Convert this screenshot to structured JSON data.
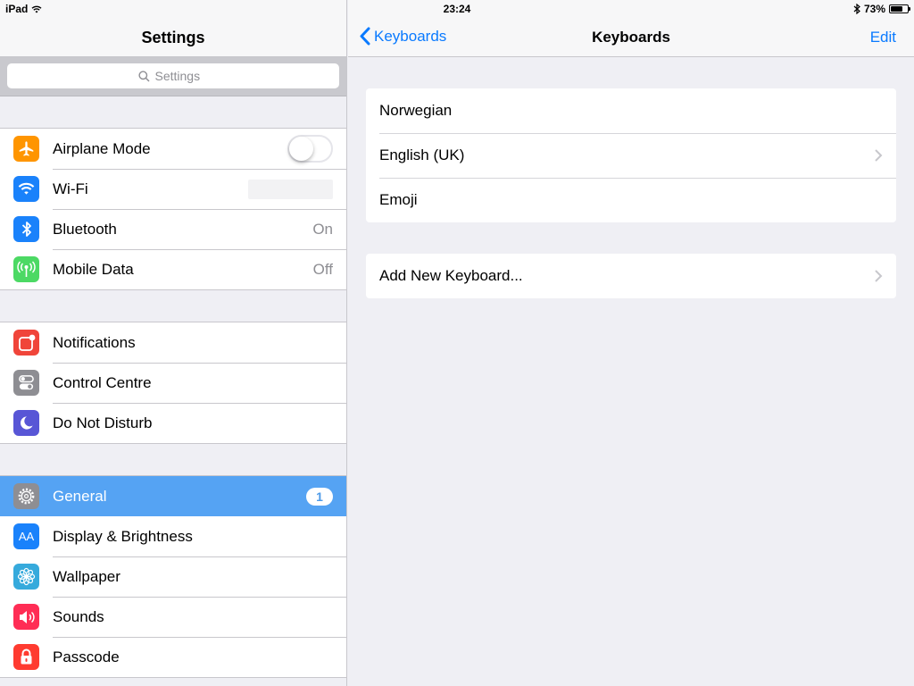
{
  "status_bar": {
    "device": "iPad",
    "time": "23:24",
    "battery": "73%",
    "battery_level": 0.73
  },
  "master": {
    "title": "Settings",
    "search_placeholder": "Settings",
    "groups": [
      [
        {
          "label": "Airplane Mode",
          "icon": "airplane-icon",
          "color": "#ff9500"
        },
        {
          "label": "Wi-Fi",
          "icon": "wifi-icon",
          "color": "#1a82fb"
        },
        {
          "label": "Bluetooth",
          "icon": "bluetooth-icon",
          "color": "#1a82fb",
          "value": "On"
        },
        {
          "label": "Mobile Data",
          "icon": "cellular-icon",
          "color": "#4cd964",
          "value": "Off"
        }
      ],
      [
        {
          "label": "Notifications",
          "icon": "notifications-icon",
          "color": "#f0453a"
        },
        {
          "label": "Control Centre",
          "icon": "control-centre-icon",
          "color": "#8e8e93"
        },
        {
          "label": "Do Not Disturb",
          "icon": "moon-icon",
          "color": "#5856d6"
        }
      ],
      [
        {
          "label": "General",
          "icon": "gear-icon",
          "color": "#8e8e93",
          "badge": "1",
          "selected": true
        },
        {
          "label": "Display & Brightness",
          "icon": "display-icon",
          "color": "#1a82fb",
          "icon_text": "AA"
        },
        {
          "label": "Wallpaper",
          "icon": "wallpaper-icon",
          "color": "#36aadc"
        },
        {
          "label": "Sounds",
          "icon": "speaker-icon",
          "color": "#ff2d55"
        },
        {
          "label": "Passcode",
          "icon": "lock-icon",
          "color": "#ff3b30"
        }
      ]
    ]
  },
  "detail": {
    "back_label": "Keyboards",
    "title": "Keyboards",
    "edit_label": "Edit",
    "keyboards": [
      {
        "label": "Norwegian",
        "chevron": false
      },
      {
        "label": "English (UK)",
        "chevron": true
      },
      {
        "label": "Emoji",
        "chevron": false
      }
    ],
    "add_keyboard_label": "Add New Keyboard..."
  },
  "colors": {
    "accent": "#0a7aff",
    "selected_row": "#55a3f3",
    "background": "#efeff4"
  }
}
